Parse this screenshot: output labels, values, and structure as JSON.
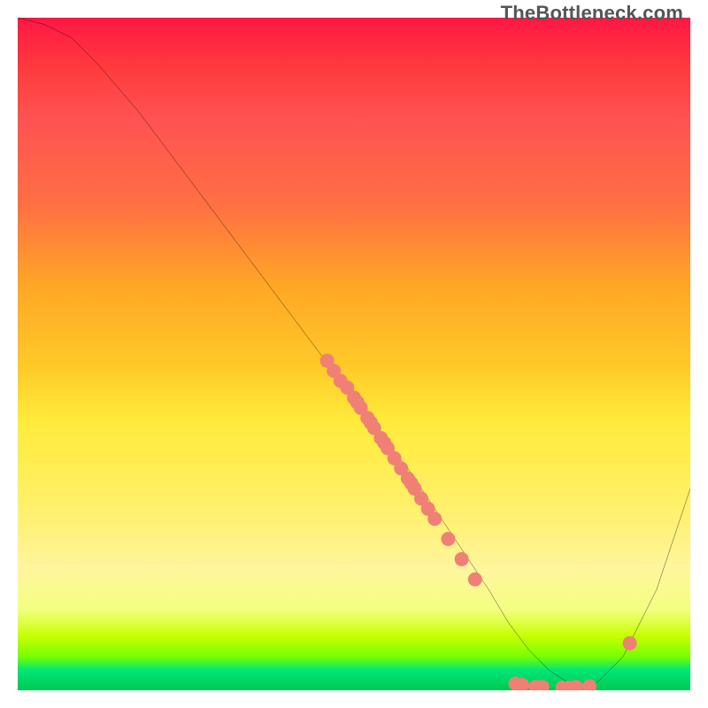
{
  "watermark": "TheBottleneck.com",
  "chart_data": {
    "type": "line",
    "title": "",
    "xlabel": "",
    "ylabel": "",
    "xlim": [
      0,
      100
    ],
    "ylim": [
      0,
      100
    ],
    "curve": {
      "name": "bottleneck-curve",
      "x": [
        0,
        4,
        8,
        12,
        18,
        24,
        30,
        36,
        42,
        48,
        54,
        58,
        62,
        66,
        70,
        73,
        76,
        79,
        82,
        85,
        90,
        95,
        100
      ],
      "y": [
        100,
        99,
        97,
        93,
        86,
        78,
        70,
        62,
        54,
        46,
        38,
        33,
        27,
        21,
        15,
        10,
        6,
        3,
        1,
        0,
        5,
        15,
        30
      ]
    },
    "markers": {
      "name": "data-points",
      "color": "#f08075",
      "radius": 8,
      "points": [
        {
          "x": 46,
          "y": 49
        },
        {
          "x": 47,
          "y": 47.5
        },
        {
          "x": 48,
          "y": 46
        },
        {
          "x": 49,
          "y": 45
        },
        {
          "x": 50,
          "y": 43.5
        },
        {
          "x": 50.5,
          "y": 42.8
        },
        {
          "x": 51,
          "y": 42
        },
        {
          "x": 52,
          "y": 40.5
        },
        {
          "x": 52.5,
          "y": 39.8
        },
        {
          "x": 53,
          "y": 39
        },
        {
          "x": 54,
          "y": 37.5
        },
        {
          "x": 54.5,
          "y": 36.8
        },
        {
          "x": 55,
          "y": 36
        },
        {
          "x": 56,
          "y": 34.5
        },
        {
          "x": 57,
          "y": 33
        },
        {
          "x": 58,
          "y": 31.5
        },
        {
          "x": 58.5,
          "y": 30.8
        },
        {
          "x": 59,
          "y": 30
        },
        {
          "x": 60,
          "y": 28.5
        },
        {
          "x": 61,
          "y": 27
        },
        {
          "x": 62,
          "y": 25.5
        },
        {
          "x": 64,
          "y": 22.5
        },
        {
          "x": 66,
          "y": 19.5
        },
        {
          "x": 68,
          "y": 16.5
        },
        {
          "x": 74,
          "y": 1
        },
        {
          "x": 75,
          "y": 0.8
        },
        {
          "x": 77,
          "y": 0.5
        },
        {
          "x": 78,
          "y": 0.5
        },
        {
          "x": 81,
          "y": 0.4
        },
        {
          "x": 82,
          "y": 0.4
        },
        {
          "x": 83,
          "y": 0.5
        },
        {
          "x": 85,
          "y": 0.6
        },
        {
          "x": 91,
          "y": 7
        }
      ]
    }
  }
}
